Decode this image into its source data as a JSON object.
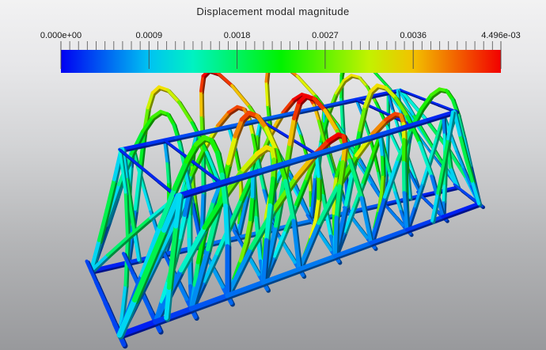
{
  "title": "Displacement modal magnitude",
  "colorbar": {
    "range": [
      0,
      0.004496
    ],
    "minor_tick_step": 9e-05,
    "ticks": [
      {
        "label": "0.000e+00",
        "value": 0
      },
      {
        "label": "0.0009",
        "value": 0.0009
      },
      {
        "label": "0.0018",
        "value": 0.0018
      },
      {
        "label": "0.0027",
        "value": 0.0027
      },
      {
        "label": "0.0036",
        "value": 0.0036
      },
      {
        "label": "4.496e-03",
        "value": 0.004496
      }
    ],
    "colormap_name": "rainbow blue-to-red",
    "colormap_stops": [
      "#0000f2",
      "#0061f2",
      "#00c2f2",
      "#00f2c2",
      "#00f261",
      "#00f200",
      "#61f200",
      "#c2f200",
      "#f2c200",
      "#f26100",
      "#f20000"
    ],
    "minor_tick_color": "#6e6e6e",
    "major_tick_color": "#4a4a4a",
    "label_color": "#151515"
  },
  "scene": {
    "subject": "3D truss arch bridge colored by modal displacement magnitude",
    "background_top": "#f2f2f3",
    "background_bottom": "#98999c",
    "min_color": "#0000f2",
    "max_color": "#f20000"
  },
  "chart_data": {
    "type": "heatmap",
    "title": "Displacement modal magnitude",
    "legend": "scalar color bar, rainbow blue to red",
    "range": [
      0,
      0.004496
    ],
    "tick_values": [
      0,
      0.0009,
      0.0018,
      0.0027,
      0.0036,
      0.004496
    ],
    "tick_labels": [
      "0.000e+00",
      "0.0009",
      "0.0018",
      "0.0027",
      "0.0036",
      "4.496e-03"
    ],
    "notes": "3D finite-element truss bridge; displacement magnitude minimal (blue) on bottom/top chords and supports, maximal (red) on mid-span arch ribs"
  }
}
